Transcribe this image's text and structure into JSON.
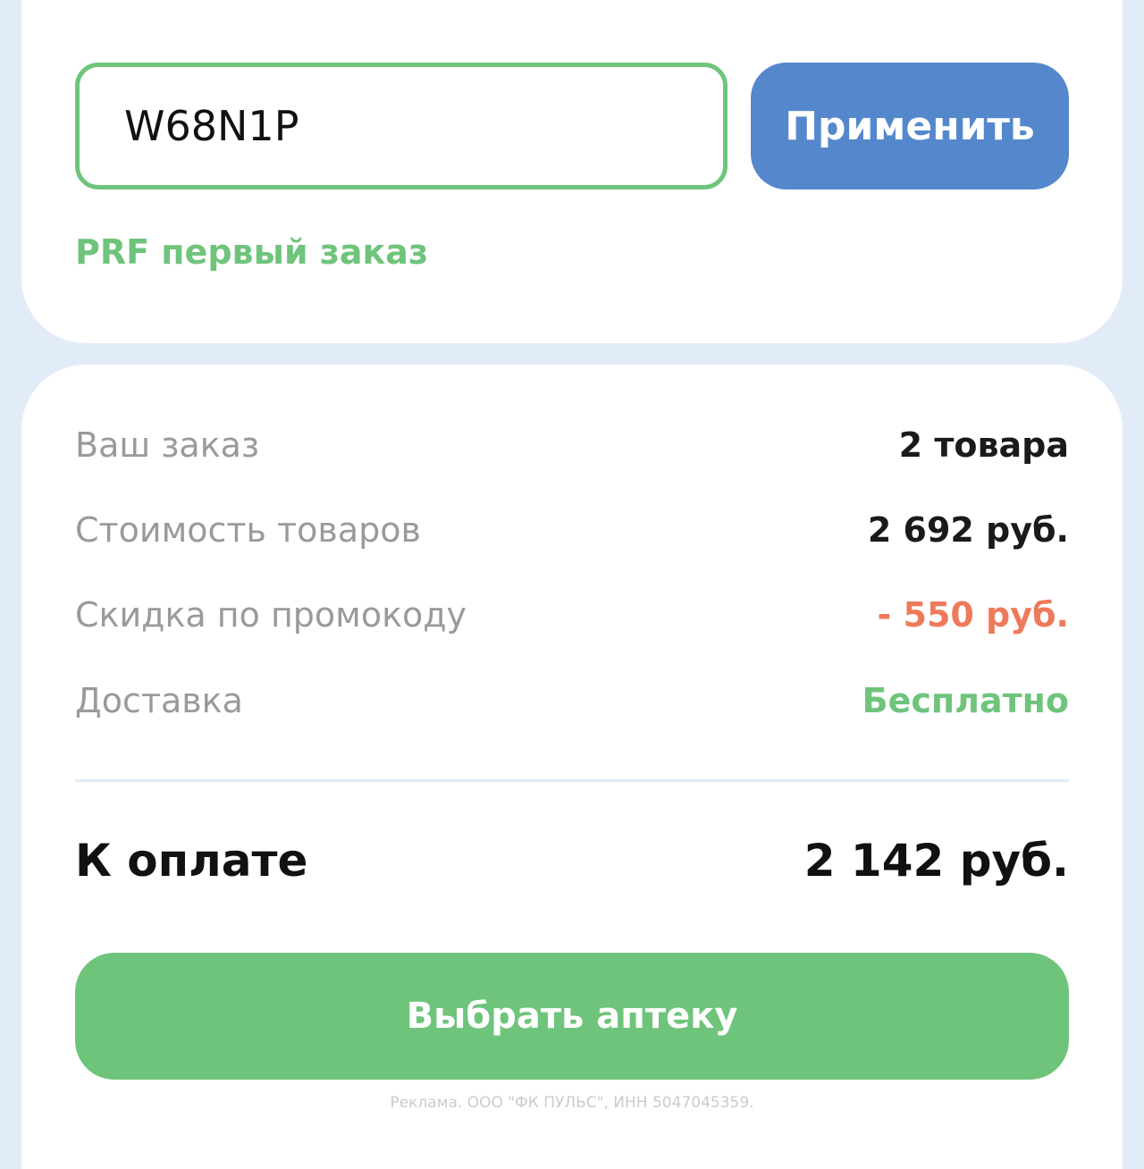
{
  "promo": {
    "code_value": "W68N1P",
    "apply_label": "Применить",
    "status_text": "PRF первый заказ"
  },
  "summary": {
    "rows": [
      {
        "label": "Ваш заказ",
        "value": "2 товара"
      },
      {
        "label": "Стоимость товаров",
        "value": "2 692 руб."
      },
      {
        "label": "Скидка по промокоду",
        "value": "- 550 руб."
      },
      {
        "label": "Доставка",
        "value": "Бесплатно"
      }
    ],
    "total_label": "К оплате",
    "total_value": "2 142 руб.",
    "choose_pharmacy_label": "Выбрать аптеку",
    "ad_note": "Реклама. ООО \"ФК ПУЛЬС\", ИНН 5047045359."
  },
  "colors": {
    "accent_green": "#6fc47b",
    "accent_blue": "#5587cc",
    "discount_red": "#ee7a5c",
    "page_background": "#e2ebf8"
  }
}
